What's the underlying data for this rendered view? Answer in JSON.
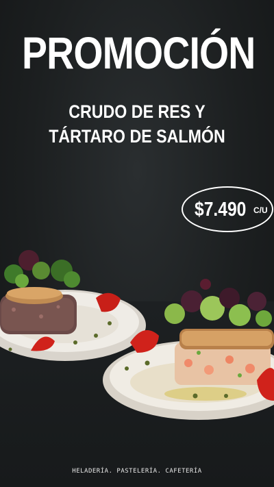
{
  "headline": "PROMOCIÓN",
  "subtitle_lines": [
    "CRUDO DE RES Y",
    "TÁRTARO DE SALMÓN"
  ],
  "price": "$7.490",
  "price_unit": "C/U",
  "footer": "HELADERÍA. PASTELERÍA. CAFETERÍA",
  "colors": {
    "background": "#1a1c1d",
    "text": "#ffffff"
  }
}
